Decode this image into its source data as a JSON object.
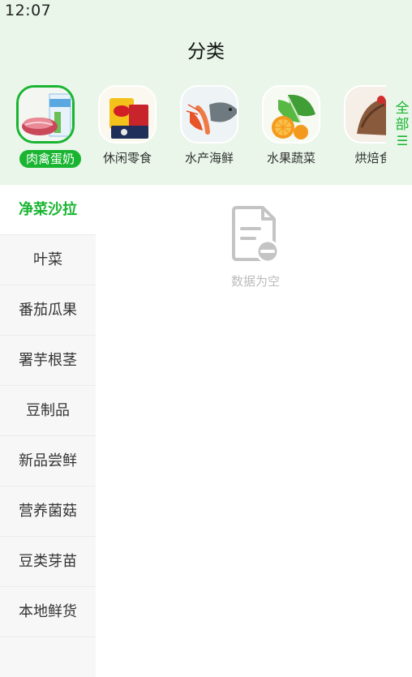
{
  "status_bar": {
    "time": "12:07"
  },
  "header": {
    "title": "分类"
  },
  "categories": [
    {
      "label": "肉禽蛋奶",
      "icon": "meat-dairy-thumbnail",
      "selected": true
    },
    {
      "label": "休闲零食",
      "icon": "snacks-thumbnail",
      "selected": false
    },
    {
      "label": "水产海鲜",
      "icon": "seafood-thumbnail",
      "selected": false
    },
    {
      "label": "水果蔬菜",
      "icon": "fruit-veg-thumbnail",
      "selected": false
    },
    {
      "label": "烘焙食",
      "icon": "bakery-thumbnail",
      "selected": false
    }
  ],
  "all_button": {
    "label_line1": "全",
    "label_line2": "部",
    "icon": "list-icon"
  },
  "sidebar": {
    "items": [
      {
        "label": "净菜沙拉",
        "active": true
      },
      {
        "label": "叶菜",
        "active": false
      },
      {
        "label": "番茄瓜果",
        "active": false
      },
      {
        "label": "署芋根茎",
        "active": false
      },
      {
        "label": "豆制品",
        "active": false
      },
      {
        "label": "新品尝鲜",
        "active": false
      },
      {
        "label": "营养菌菇",
        "active": false
      },
      {
        "label": "豆类芽苗",
        "active": false
      },
      {
        "label": "本地鲜货",
        "active": false
      }
    ]
  },
  "empty_state": {
    "text": "数据为空",
    "icon": "empty-document-icon"
  },
  "colors": {
    "accent": "#19b531",
    "header_bg": "#e9f6e9",
    "empty_text": "#bbbbbb"
  }
}
